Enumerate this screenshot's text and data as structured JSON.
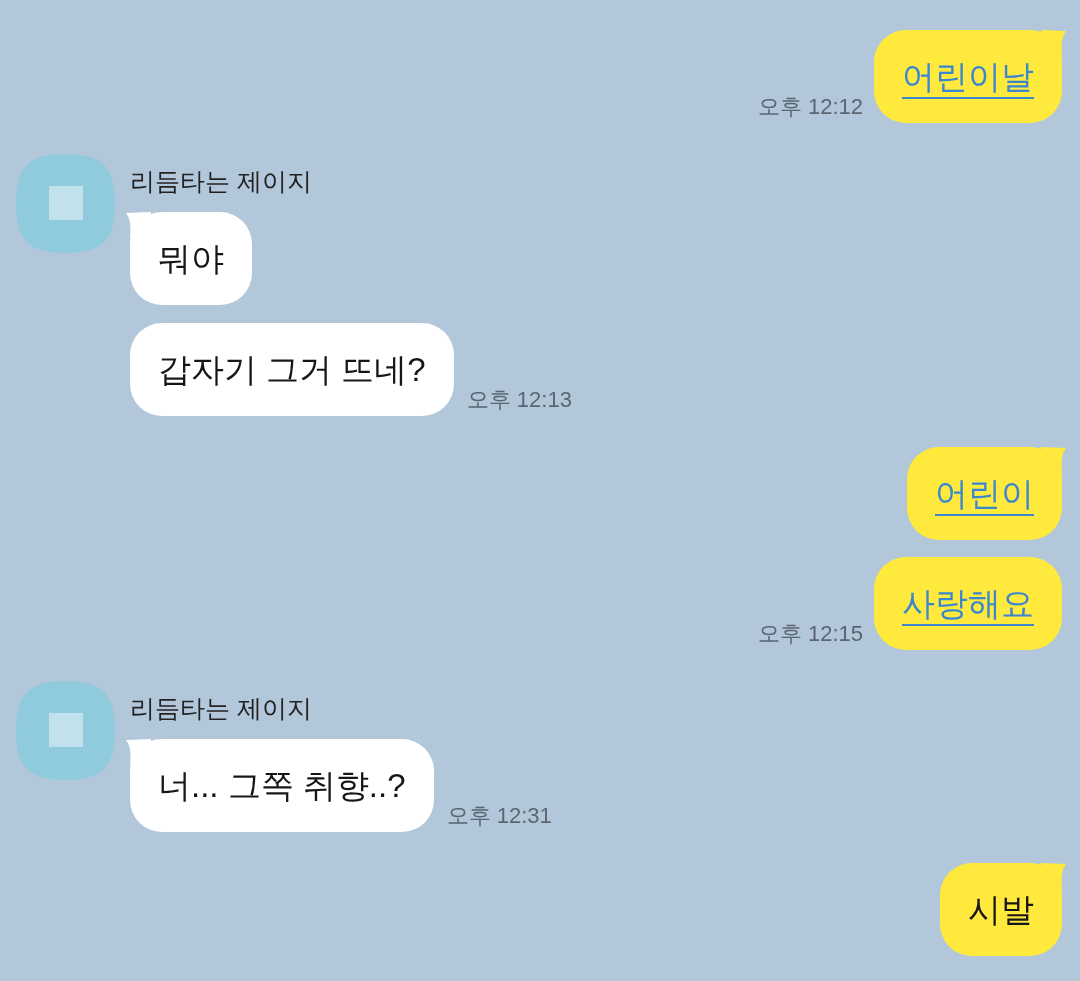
{
  "messages": [
    {
      "kind": "sent",
      "bubbles": [
        {
          "text": "어린이날",
          "link": true
        }
      ],
      "time": "오후 12:12"
    },
    {
      "kind": "received",
      "sender": "리듬타는 제이지",
      "bubbles": [
        {
          "text": "뭐야",
          "link": false
        },
        {
          "text": "갑자기 그거 뜨네?",
          "link": false
        }
      ],
      "time": "오후 12:13"
    },
    {
      "kind": "sent",
      "bubbles": [
        {
          "text": "어린이",
          "link": true
        },
        {
          "text": "사랑해요",
          "link": true
        }
      ],
      "time": "오후 12:15"
    },
    {
      "kind": "received",
      "sender": "리듬타는 제이지",
      "bubbles": [
        {
          "text": "너... 그쪽 취향..?",
          "link": false
        }
      ],
      "time": "오후 12:31"
    },
    {
      "kind": "sent",
      "bubbles": [
        {
          "text": "시발",
          "link": false
        }
      ]
    }
  ]
}
